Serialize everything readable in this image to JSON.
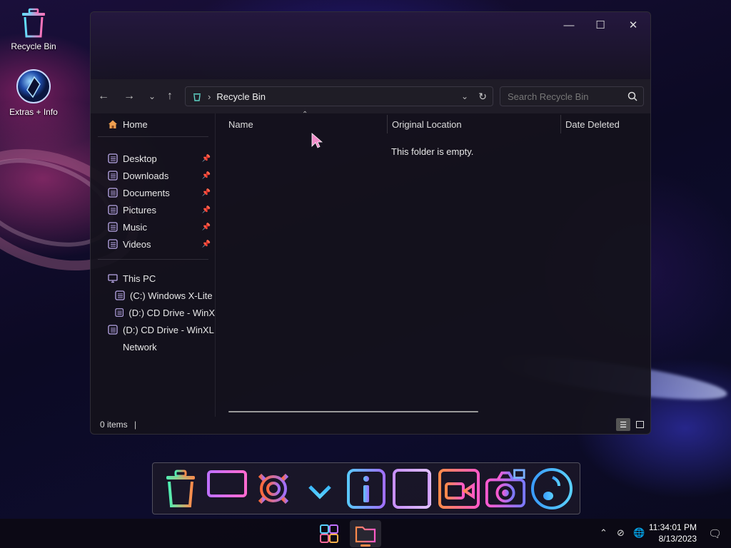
{
  "desktop": {
    "icons": [
      {
        "label": "Recycle Bin",
        "icon": "recycle-bin-icon"
      },
      {
        "label": "Extras + Info",
        "icon": "extras-info-icon"
      }
    ]
  },
  "window": {
    "controls": {
      "minimize": "—",
      "maximize": "☐",
      "close": "✕"
    },
    "address": {
      "current": "Recycle Bin",
      "separator": "›"
    },
    "search": {
      "placeholder": "Search Recycle Bin"
    },
    "sidebar": {
      "home": "Home",
      "quick_access": [
        {
          "label": "Desktop",
          "pinned": true
        },
        {
          "label": "Downloads",
          "pinned": true
        },
        {
          "label": "Documents",
          "pinned": true
        },
        {
          "label": "Pictures",
          "pinned": true
        },
        {
          "label": "Music",
          "pinned": true
        },
        {
          "label": "Videos",
          "pinned": true
        }
      ],
      "this_pc": "This PC",
      "drives": [
        "(C:) Windows X-Lite",
        "(D:) CD Drive - WinX"
      ],
      "extra_drive": "(D:) CD Drive - WinXL",
      "network": "Network"
    },
    "columns": [
      "Name",
      "Original Location",
      "Date Deleted"
    ],
    "empty_message": "This folder is empty.",
    "status": {
      "items": "0 items"
    }
  },
  "dock": {
    "items": [
      "recycle-bin-icon",
      "monitor-icon",
      "gear-icon",
      "download-icon",
      "info-icon",
      "document-icon",
      "video-camera-icon",
      "camera-icon",
      "music-icon"
    ]
  },
  "taskbar": {
    "time": "11:34:01 PM",
    "date": "8/13/2023",
    "apps": [
      "start-icon",
      "file-explorer-icon"
    ]
  },
  "colors": {
    "accent": "#7b5cff",
    "icon_purple": "#b9a8e8",
    "window_bg": "#14121c"
  }
}
